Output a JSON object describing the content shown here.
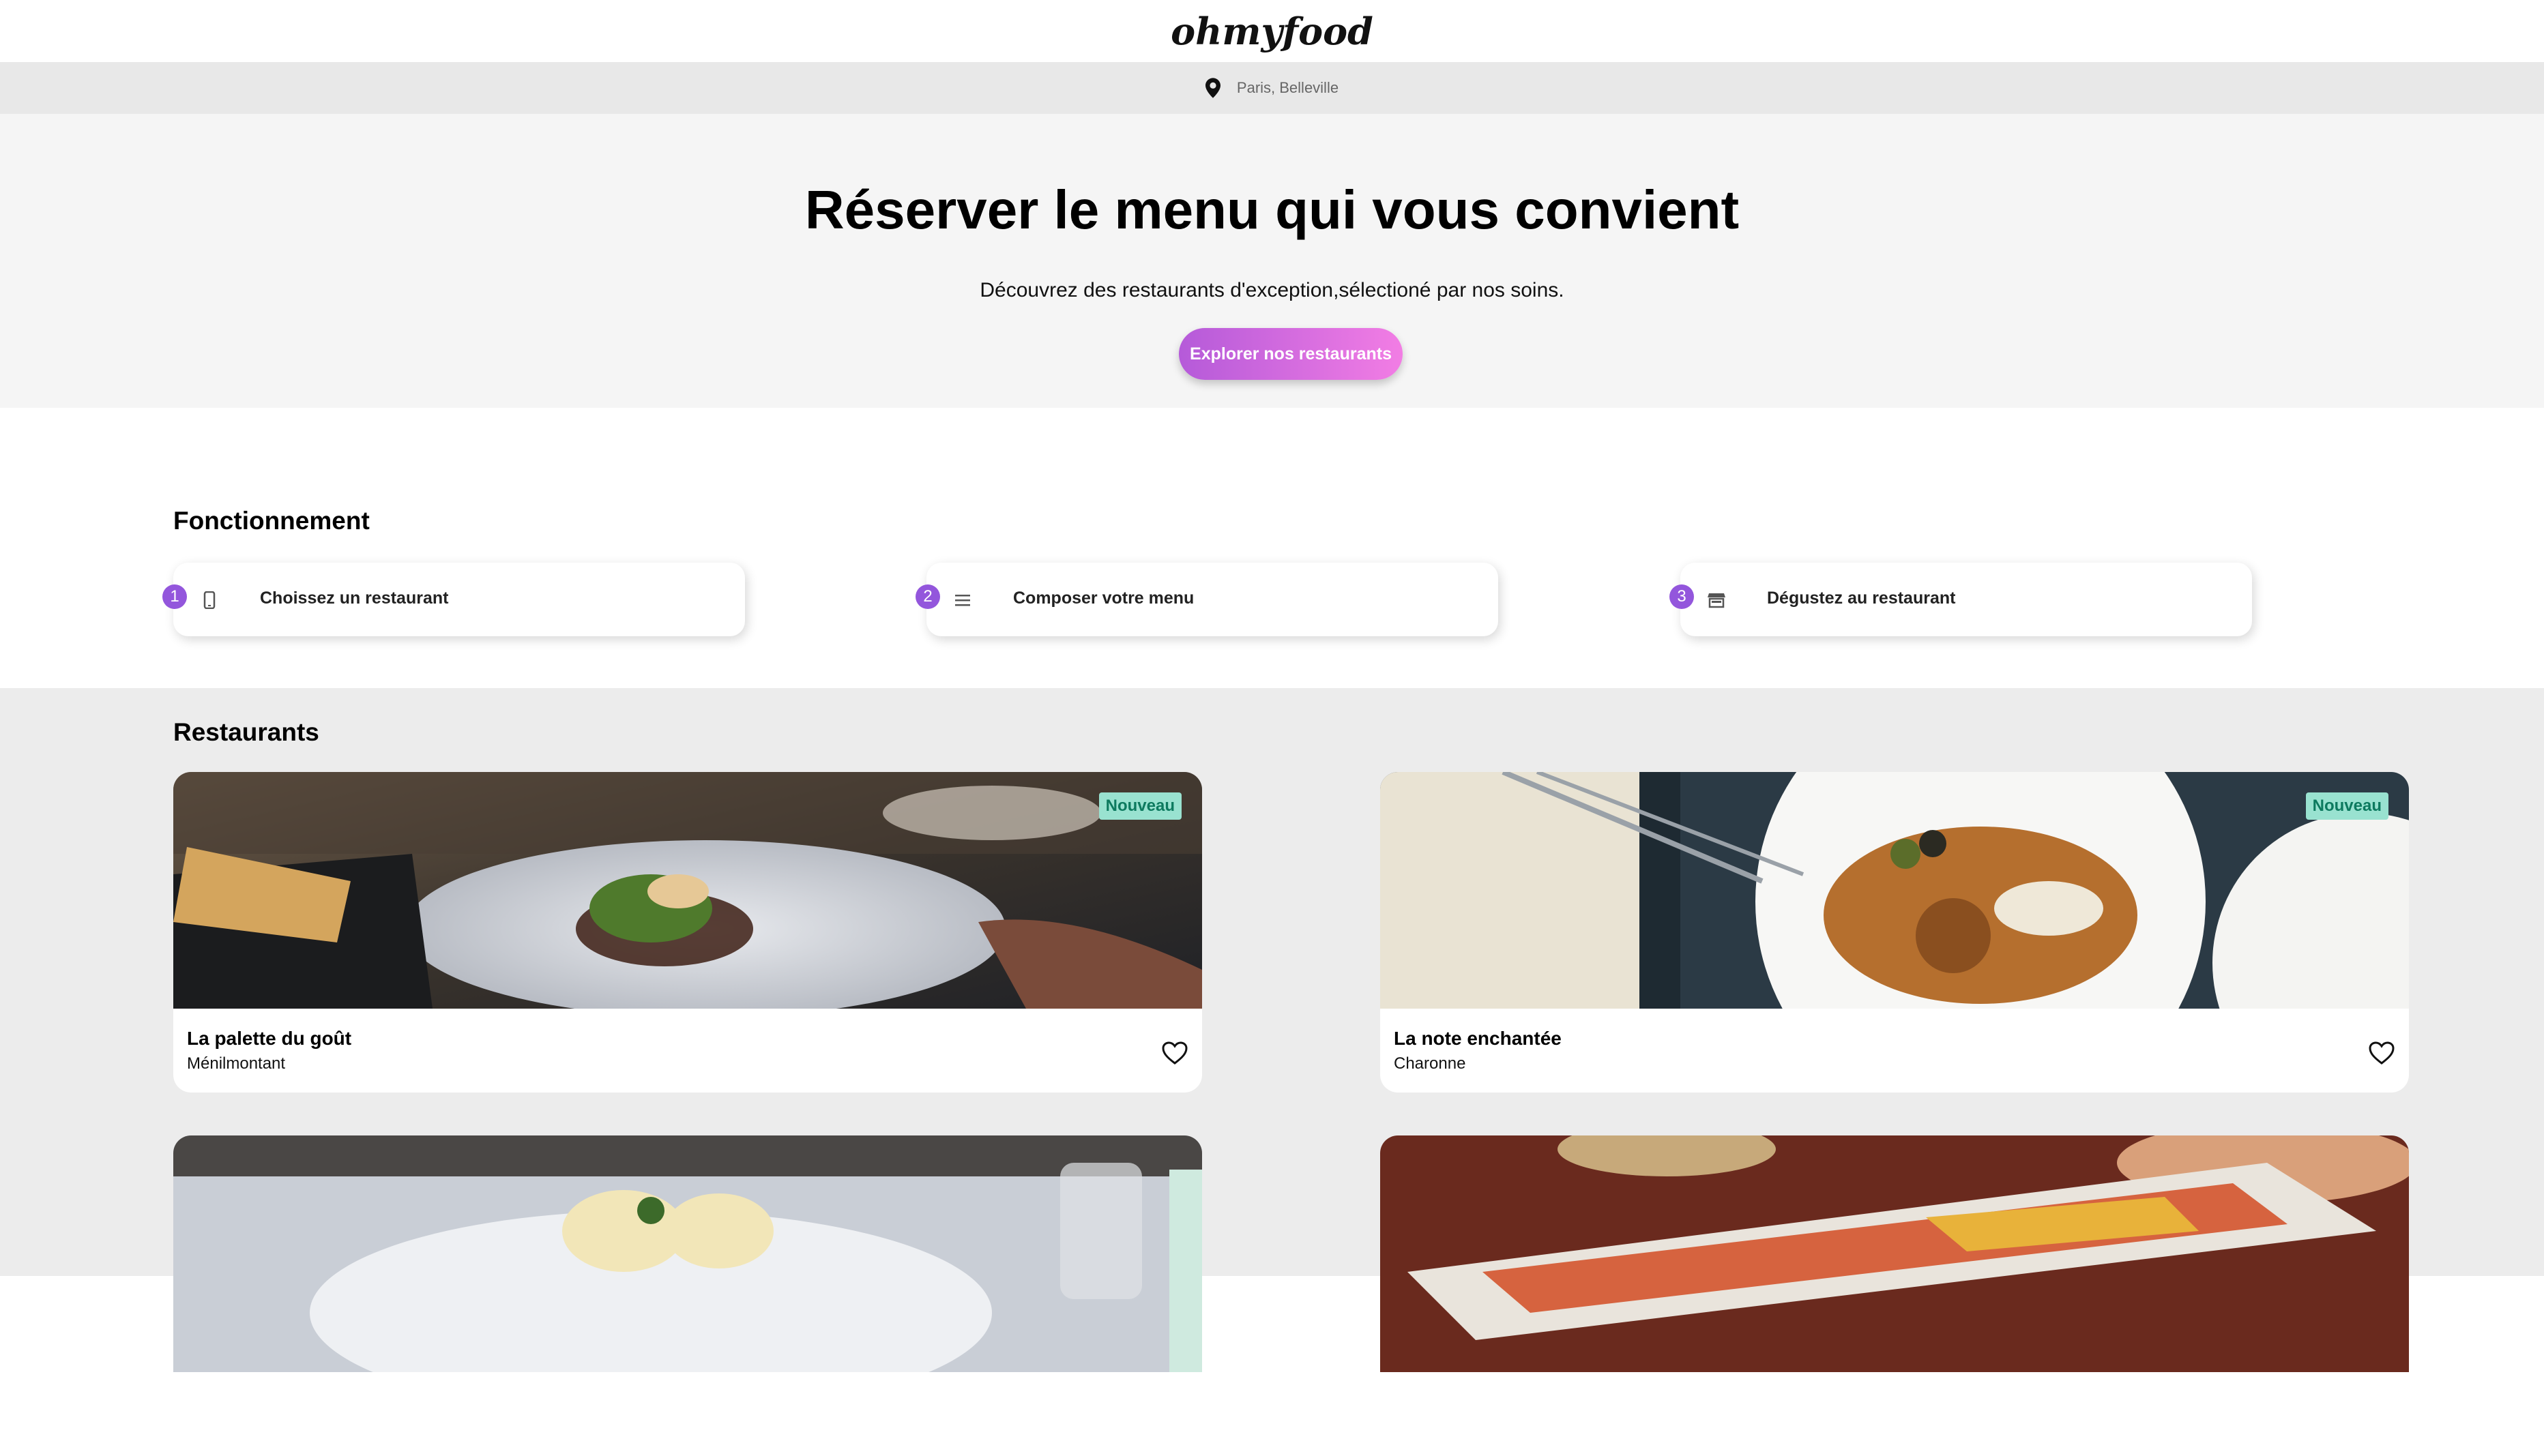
{
  "header": {
    "logo": "ohmyfood"
  },
  "location": {
    "text": "Paris, Belleville",
    "icon": "location-pin-icon"
  },
  "hero": {
    "title": "Réserver le menu qui vous convient",
    "subtitle": "Découvrez des restaurants d'exception,sélectioné par nos soins.",
    "cta_label": "Explorer nos restaurants"
  },
  "how_it_works": {
    "title": "Fonctionnement",
    "steps": [
      {
        "number": "1",
        "label": "Choissez un restaurant",
        "icon": "mobile-phone-icon"
      },
      {
        "number": "2",
        "label": "Composer votre menu",
        "icon": "list-icon"
      },
      {
        "number": "3",
        "label": "Dégustez au restaurant",
        "icon": "storefront-icon"
      }
    ]
  },
  "restaurants": {
    "title": "Restaurants",
    "items": [
      {
        "name": "La palette du goût",
        "district": "Ménilmontant",
        "badge": "Nouveau"
      },
      {
        "name": "La note enchantée",
        "district": "Charonne",
        "badge": "Nouveau"
      },
      {
        "name": "",
        "district": "",
        "badge": ""
      },
      {
        "name": "",
        "district": "",
        "badge": ""
      }
    ]
  },
  "colors": {
    "accent": "#9356dc",
    "accent_light": "#ff79da",
    "badge_bg": "#99e2d0",
    "badge_text": "#0d7a5f"
  }
}
